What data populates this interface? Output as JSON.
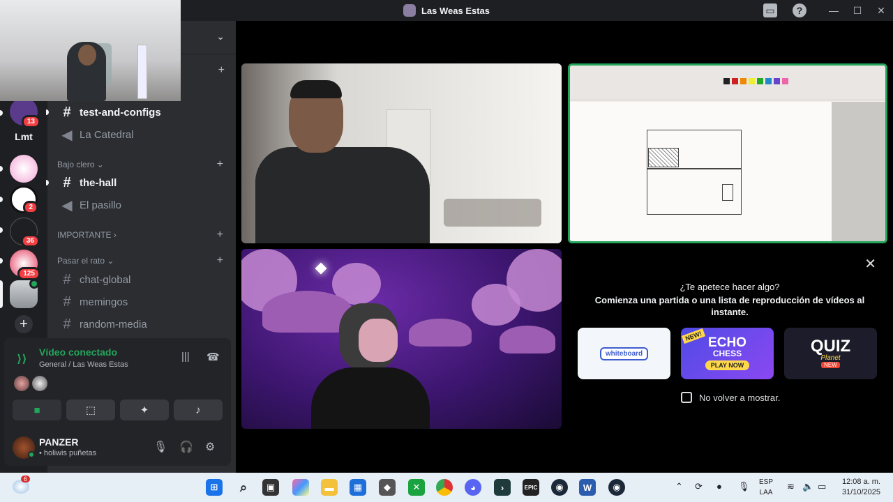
{
  "window": {
    "title": "Las Weas Estas"
  },
  "guild_badges": [
    "13",
    "2",
    "36",
    "125"
  ],
  "guild_text": "Lmt",
  "channels": {
    "ch1": "test-and-configs",
    "ch2": "La Catedral",
    "cat1": "Bajo clero",
    "ch3": "the-hall",
    "ch4": "El pasillo",
    "cat2": "IMPORTANTE",
    "cat3": "Pasar el rato",
    "ch5": "chat-global",
    "ch6": "memingos",
    "ch7": "random-media"
  },
  "voice": {
    "title": "Vídeo conectado",
    "subtitle": "General / Las Weas Estas"
  },
  "user": {
    "name": "PANZER",
    "status": "• holiwis puñetas"
  },
  "activity": {
    "question": "¿Te apetece hacer algo?",
    "description": "Comienza una partida o una lista de reproducción de vídeos al instante.",
    "cards": {
      "whiteboard": "whiteboard",
      "echo_new": "NEW!",
      "echo_title": "ECHO",
      "echo_sub": "CHESS",
      "echo_play": "PLAY NOW",
      "quiz_title": "QUIZ",
      "quiz_sub": "Planet",
      "quiz_new": "NEW"
    },
    "dont_show": "No volver a mostrar."
  },
  "taskbar": {
    "weather_badge": "6",
    "lang1": "ESP",
    "lang2": "LAA",
    "time": "12:08 a. m.",
    "date": "31/10/2025"
  }
}
